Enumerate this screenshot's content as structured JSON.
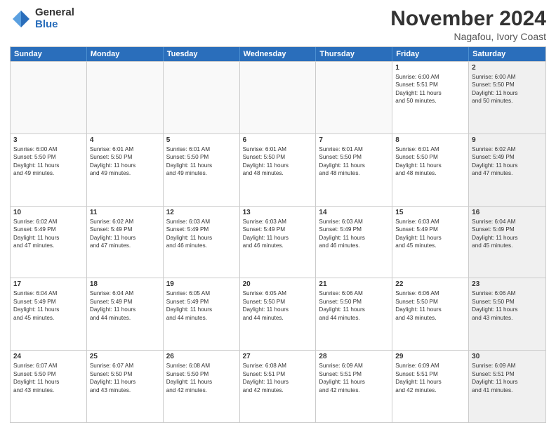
{
  "logo": {
    "general": "General",
    "blue": "Blue"
  },
  "title": "November 2024",
  "location": "Nagafou, Ivory Coast",
  "weekdays": [
    "Sunday",
    "Monday",
    "Tuesday",
    "Wednesday",
    "Thursday",
    "Friday",
    "Saturday"
  ],
  "weeks": [
    [
      {
        "day": "",
        "info": "",
        "empty": true
      },
      {
        "day": "",
        "info": "",
        "empty": true
      },
      {
        "day": "",
        "info": "",
        "empty": true
      },
      {
        "day": "",
        "info": "",
        "empty": true
      },
      {
        "day": "",
        "info": "",
        "empty": true
      },
      {
        "day": "1",
        "info": "Sunrise: 6:00 AM\nSunset: 5:51 PM\nDaylight: 11 hours\nand 50 minutes.",
        "empty": false,
        "shaded": false
      },
      {
        "day": "2",
        "info": "Sunrise: 6:00 AM\nSunset: 5:50 PM\nDaylight: 11 hours\nand 50 minutes.",
        "empty": false,
        "shaded": true
      }
    ],
    [
      {
        "day": "3",
        "info": "Sunrise: 6:00 AM\nSunset: 5:50 PM\nDaylight: 11 hours\nand 49 minutes.",
        "shaded": false
      },
      {
        "day": "4",
        "info": "Sunrise: 6:01 AM\nSunset: 5:50 PM\nDaylight: 11 hours\nand 49 minutes.",
        "shaded": false
      },
      {
        "day": "5",
        "info": "Sunrise: 6:01 AM\nSunset: 5:50 PM\nDaylight: 11 hours\nand 49 minutes.",
        "shaded": false
      },
      {
        "day": "6",
        "info": "Sunrise: 6:01 AM\nSunset: 5:50 PM\nDaylight: 11 hours\nand 48 minutes.",
        "shaded": false
      },
      {
        "day": "7",
        "info": "Sunrise: 6:01 AM\nSunset: 5:50 PM\nDaylight: 11 hours\nand 48 minutes.",
        "shaded": false
      },
      {
        "day": "8",
        "info": "Sunrise: 6:01 AM\nSunset: 5:50 PM\nDaylight: 11 hours\nand 48 minutes.",
        "shaded": false
      },
      {
        "day": "9",
        "info": "Sunrise: 6:02 AM\nSunset: 5:49 PM\nDaylight: 11 hours\nand 47 minutes.",
        "shaded": true
      }
    ],
    [
      {
        "day": "10",
        "info": "Sunrise: 6:02 AM\nSunset: 5:49 PM\nDaylight: 11 hours\nand 47 minutes.",
        "shaded": false
      },
      {
        "day": "11",
        "info": "Sunrise: 6:02 AM\nSunset: 5:49 PM\nDaylight: 11 hours\nand 47 minutes.",
        "shaded": false
      },
      {
        "day": "12",
        "info": "Sunrise: 6:03 AM\nSunset: 5:49 PM\nDaylight: 11 hours\nand 46 minutes.",
        "shaded": false
      },
      {
        "day": "13",
        "info": "Sunrise: 6:03 AM\nSunset: 5:49 PM\nDaylight: 11 hours\nand 46 minutes.",
        "shaded": false
      },
      {
        "day": "14",
        "info": "Sunrise: 6:03 AM\nSunset: 5:49 PM\nDaylight: 11 hours\nand 46 minutes.",
        "shaded": false
      },
      {
        "day": "15",
        "info": "Sunrise: 6:03 AM\nSunset: 5:49 PM\nDaylight: 11 hours\nand 45 minutes.",
        "shaded": false
      },
      {
        "day": "16",
        "info": "Sunrise: 6:04 AM\nSunset: 5:49 PM\nDaylight: 11 hours\nand 45 minutes.",
        "shaded": true
      }
    ],
    [
      {
        "day": "17",
        "info": "Sunrise: 6:04 AM\nSunset: 5:49 PM\nDaylight: 11 hours\nand 45 minutes.",
        "shaded": false
      },
      {
        "day": "18",
        "info": "Sunrise: 6:04 AM\nSunset: 5:49 PM\nDaylight: 11 hours\nand 44 minutes.",
        "shaded": false
      },
      {
        "day": "19",
        "info": "Sunrise: 6:05 AM\nSunset: 5:49 PM\nDaylight: 11 hours\nand 44 minutes.",
        "shaded": false
      },
      {
        "day": "20",
        "info": "Sunrise: 6:05 AM\nSunset: 5:50 PM\nDaylight: 11 hours\nand 44 minutes.",
        "shaded": false
      },
      {
        "day": "21",
        "info": "Sunrise: 6:06 AM\nSunset: 5:50 PM\nDaylight: 11 hours\nand 44 minutes.",
        "shaded": false
      },
      {
        "day": "22",
        "info": "Sunrise: 6:06 AM\nSunset: 5:50 PM\nDaylight: 11 hours\nand 43 minutes.",
        "shaded": false
      },
      {
        "day": "23",
        "info": "Sunrise: 6:06 AM\nSunset: 5:50 PM\nDaylight: 11 hours\nand 43 minutes.",
        "shaded": true
      }
    ],
    [
      {
        "day": "24",
        "info": "Sunrise: 6:07 AM\nSunset: 5:50 PM\nDaylight: 11 hours\nand 43 minutes.",
        "shaded": false
      },
      {
        "day": "25",
        "info": "Sunrise: 6:07 AM\nSunset: 5:50 PM\nDaylight: 11 hours\nand 43 minutes.",
        "shaded": false
      },
      {
        "day": "26",
        "info": "Sunrise: 6:08 AM\nSunset: 5:50 PM\nDaylight: 11 hours\nand 42 minutes.",
        "shaded": false
      },
      {
        "day": "27",
        "info": "Sunrise: 6:08 AM\nSunset: 5:51 PM\nDaylight: 11 hours\nand 42 minutes.",
        "shaded": false
      },
      {
        "day": "28",
        "info": "Sunrise: 6:09 AM\nSunset: 5:51 PM\nDaylight: 11 hours\nand 42 minutes.",
        "shaded": false
      },
      {
        "day": "29",
        "info": "Sunrise: 6:09 AM\nSunset: 5:51 PM\nDaylight: 11 hours\nand 42 minutes.",
        "shaded": false
      },
      {
        "day": "30",
        "info": "Sunrise: 6:09 AM\nSunset: 5:51 PM\nDaylight: 11 hours\nand 41 minutes.",
        "shaded": true
      }
    ]
  ]
}
